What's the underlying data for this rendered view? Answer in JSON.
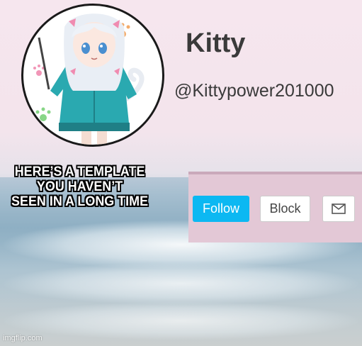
{
  "profile": {
    "username": "Kitty",
    "handle": "@Kittypower201000"
  },
  "caption": {
    "line1": "HERE’S A TEMPLATE",
    "line2": "YOU HAVEN’T",
    "line3": "SEEN IN A LONG TIME"
  },
  "actions": {
    "follow_label": "Follow",
    "block_label": "Block",
    "message_icon": "envelope-icon"
  },
  "watermark": "imgflip.com",
  "colors": {
    "follow_button": "#0cb8f2",
    "panel": "#e3c8d6",
    "avatar_jacket": "#2aa9b0",
    "avatar_hair": "#e9eef5"
  }
}
